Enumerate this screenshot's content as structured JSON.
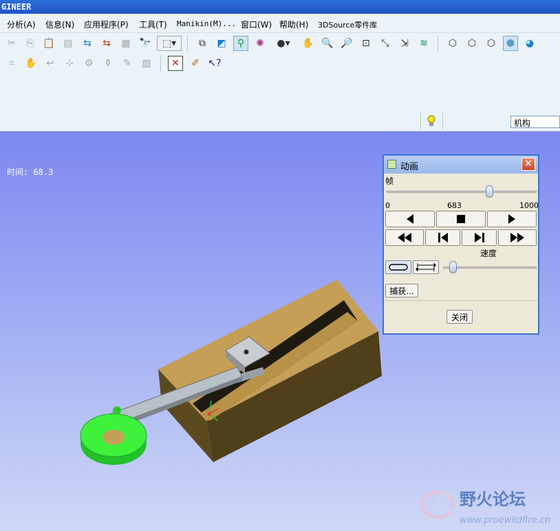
{
  "titlebar": {
    "title": "GINEER"
  },
  "menu": [
    "分析(A)",
    "信息(N)",
    "应用程序(P)",
    "工具(T)",
    "Manikin(M)...",
    "窗口(W)",
    "帮助(H)",
    "3DSource零件库"
  ],
  "toolbar": {
    "row1_icons": [
      "cut-icon",
      "copy-icon",
      "paste-icon",
      "paste-special-icon",
      "regenerate-icon",
      "regenerate-manager-icon",
      "select-icon",
      "find-icon",
      "selection-box-icon",
      "model-tree-icon",
      "datum-display-icon",
      "mechanism-icon",
      "spin-center-icon",
      "shading-icon",
      "pan-icon",
      "zoom-in-icon",
      "zoom-out-icon",
      "refit-icon",
      "orient-icon",
      "saved-views-icon",
      "layers-icon",
      "wireframe-icon",
      "hidden-line-icon",
      "no-hidden-icon",
      "shaded-icon",
      "appearance-icon"
    ],
    "row2_icons": [
      "datum-plane-icon",
      "datum-axis-icon",
      "datum-curve-icon",
      "datum-point-icon",
      "coordsys-icon",
      "analysis-icon",
      "sketch-icon",
      "cosmetic-icon",
      "close-window-icon",
      "annotate-icon",
      "whats-this-icon"
    ]
  },
  "filter": {
    "value": "机构"
  },
  "viewport": {
    "time_label": "时间: 68.3"
  },
  "dialog": {
    "title": "动画",
    "frame_label": "帧",
    "frame_min": "0",
    "frame_current": "683",
    "frame_max": "1000",
    "frame_value": 0.683,
    "speed_label": "速度",
    "speed_value": 0.1,
    "capture_label": "捕获...",
    "close_label": "关闭"
  },
  "watermark": {
    "title": "野火论坛",
    "url": "www.proewildfire.cn"
  }
}
